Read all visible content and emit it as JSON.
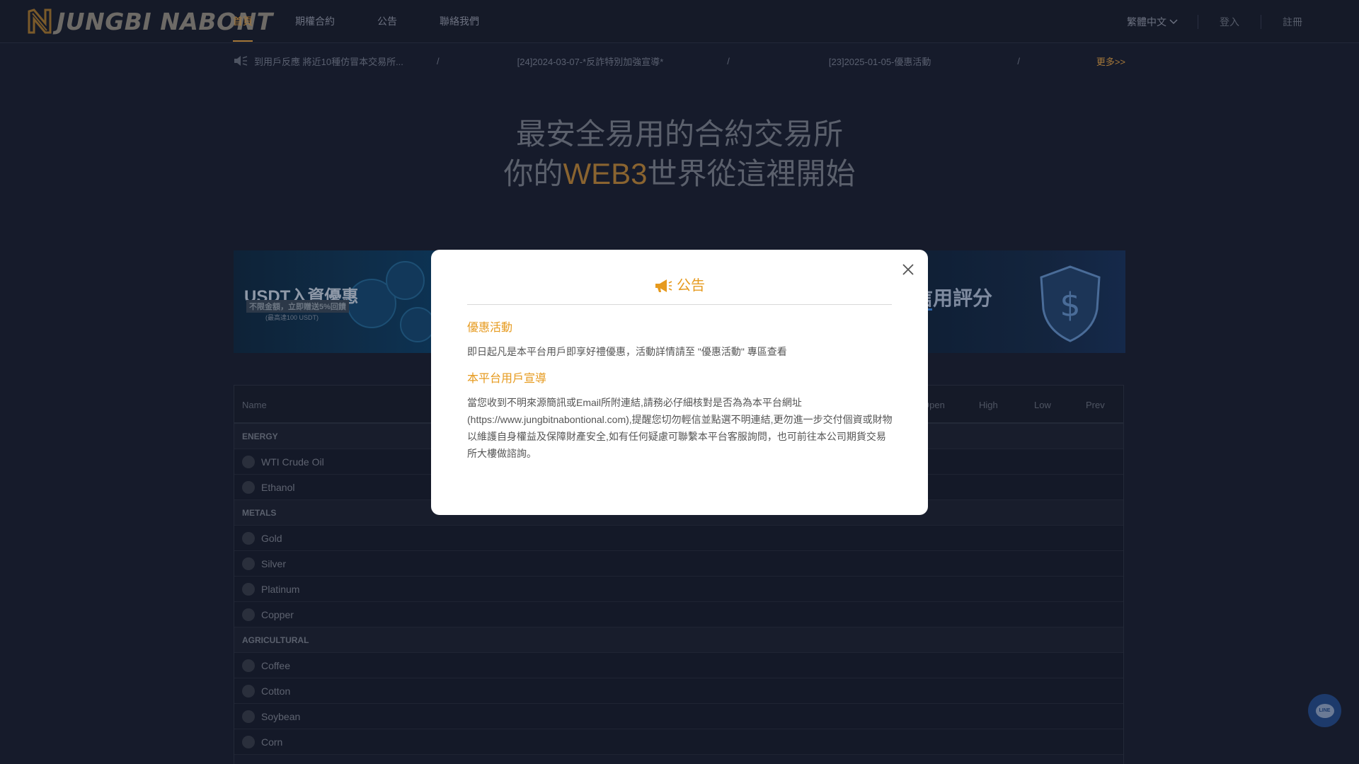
{
  "brand": {
    "logo_text": "JUNGBI NABONT"
  },
  "nav": {
    "items": [
      {
        "label": "首頁",
        "active": true
      },
      {
        "label": "期權合約",
        "active": false
      },
      {
        "label": "公告",
        "active": false
      },
      {
        "label": "聯絡我們",
        "active": false
      }
    ]
  },
  "header_right": {
    "language": "繁體中文",
    "login": "登入",
    "register": "註冊"
  },
  "ticker": {
    "items": [
      "到用戶反應 將近10種仿冒本交易所...",
      "[24]2024-03-07-*反詐特別加強宣導*",
      "[23]2025-01-05-優惠活動"
    ],
    "separator": "/",
    "more": "更多>>"
  },
  "hero": {
    "line1": "最安全易用的合約交易所",
    "line2_prefix": "你的",
    "line2_accent": "WEB3",
    "line2_suffix": "世界從這裡開始"
  },
  "banners": {
    "left": {
      "title": "USDT入資優惠",
      "subtitle": "不限金額，立即贈送5%回饋",
      "note": "(最高達100 USDT)"
    },
    "right": {
      "title": "信用評分"
    }
  },
  "market": {
    "columns": [
      "Name",
      "Open",
      "High",
      "Low",
      "Prev"
    ],
    "categories": [
      {
        "name": "ENERGY",
        "rows": [
          "WTI Crude Oil",
          "Ethanol"
        ]
      },
      {
        "name": "METALS",
        "rows": [
          "Gold",
          "Silver",
          "Platinum",
          "Copper"
        ]
      },
      {
        "name": "AGRICULTURAL",
        "rows": [
          "Coffee",
          "Cotton",
          "Soybean",
          "Corn"
        ]
      }
    ]
  },
  "chat": {
    "label": "LINE"
  },
  "modal": {
    "title": "公告",
    "sections": [
      {
        "title": "優惠活動",
        "text": "即日起凡是本平台用戶即享好禮優惠，活動詳情請至 \"優惠活動\" 專區查看"
      },
      {
        "title": "本平台用戶宣導",
        "text": "當您收到不明來源簡訊或Email所附連結,請務必仔細核對是否為為本平台網址(https://www.jungbitnabontional.com),提醒您切勿輕信並點選不明連結,更勿進一步交付個資或財物以維護自身權益及保障財產安全,如有任何疑慮可聯繫本平台客服詢問，也可前往本公司期貨交易所大樓做諮詢。"
      }
    ]
  },
  "colors": {
    "accent": "#e69a1e",
    "nav_active": "#a5783a",
    "background": "#161b2b"
  }
}
